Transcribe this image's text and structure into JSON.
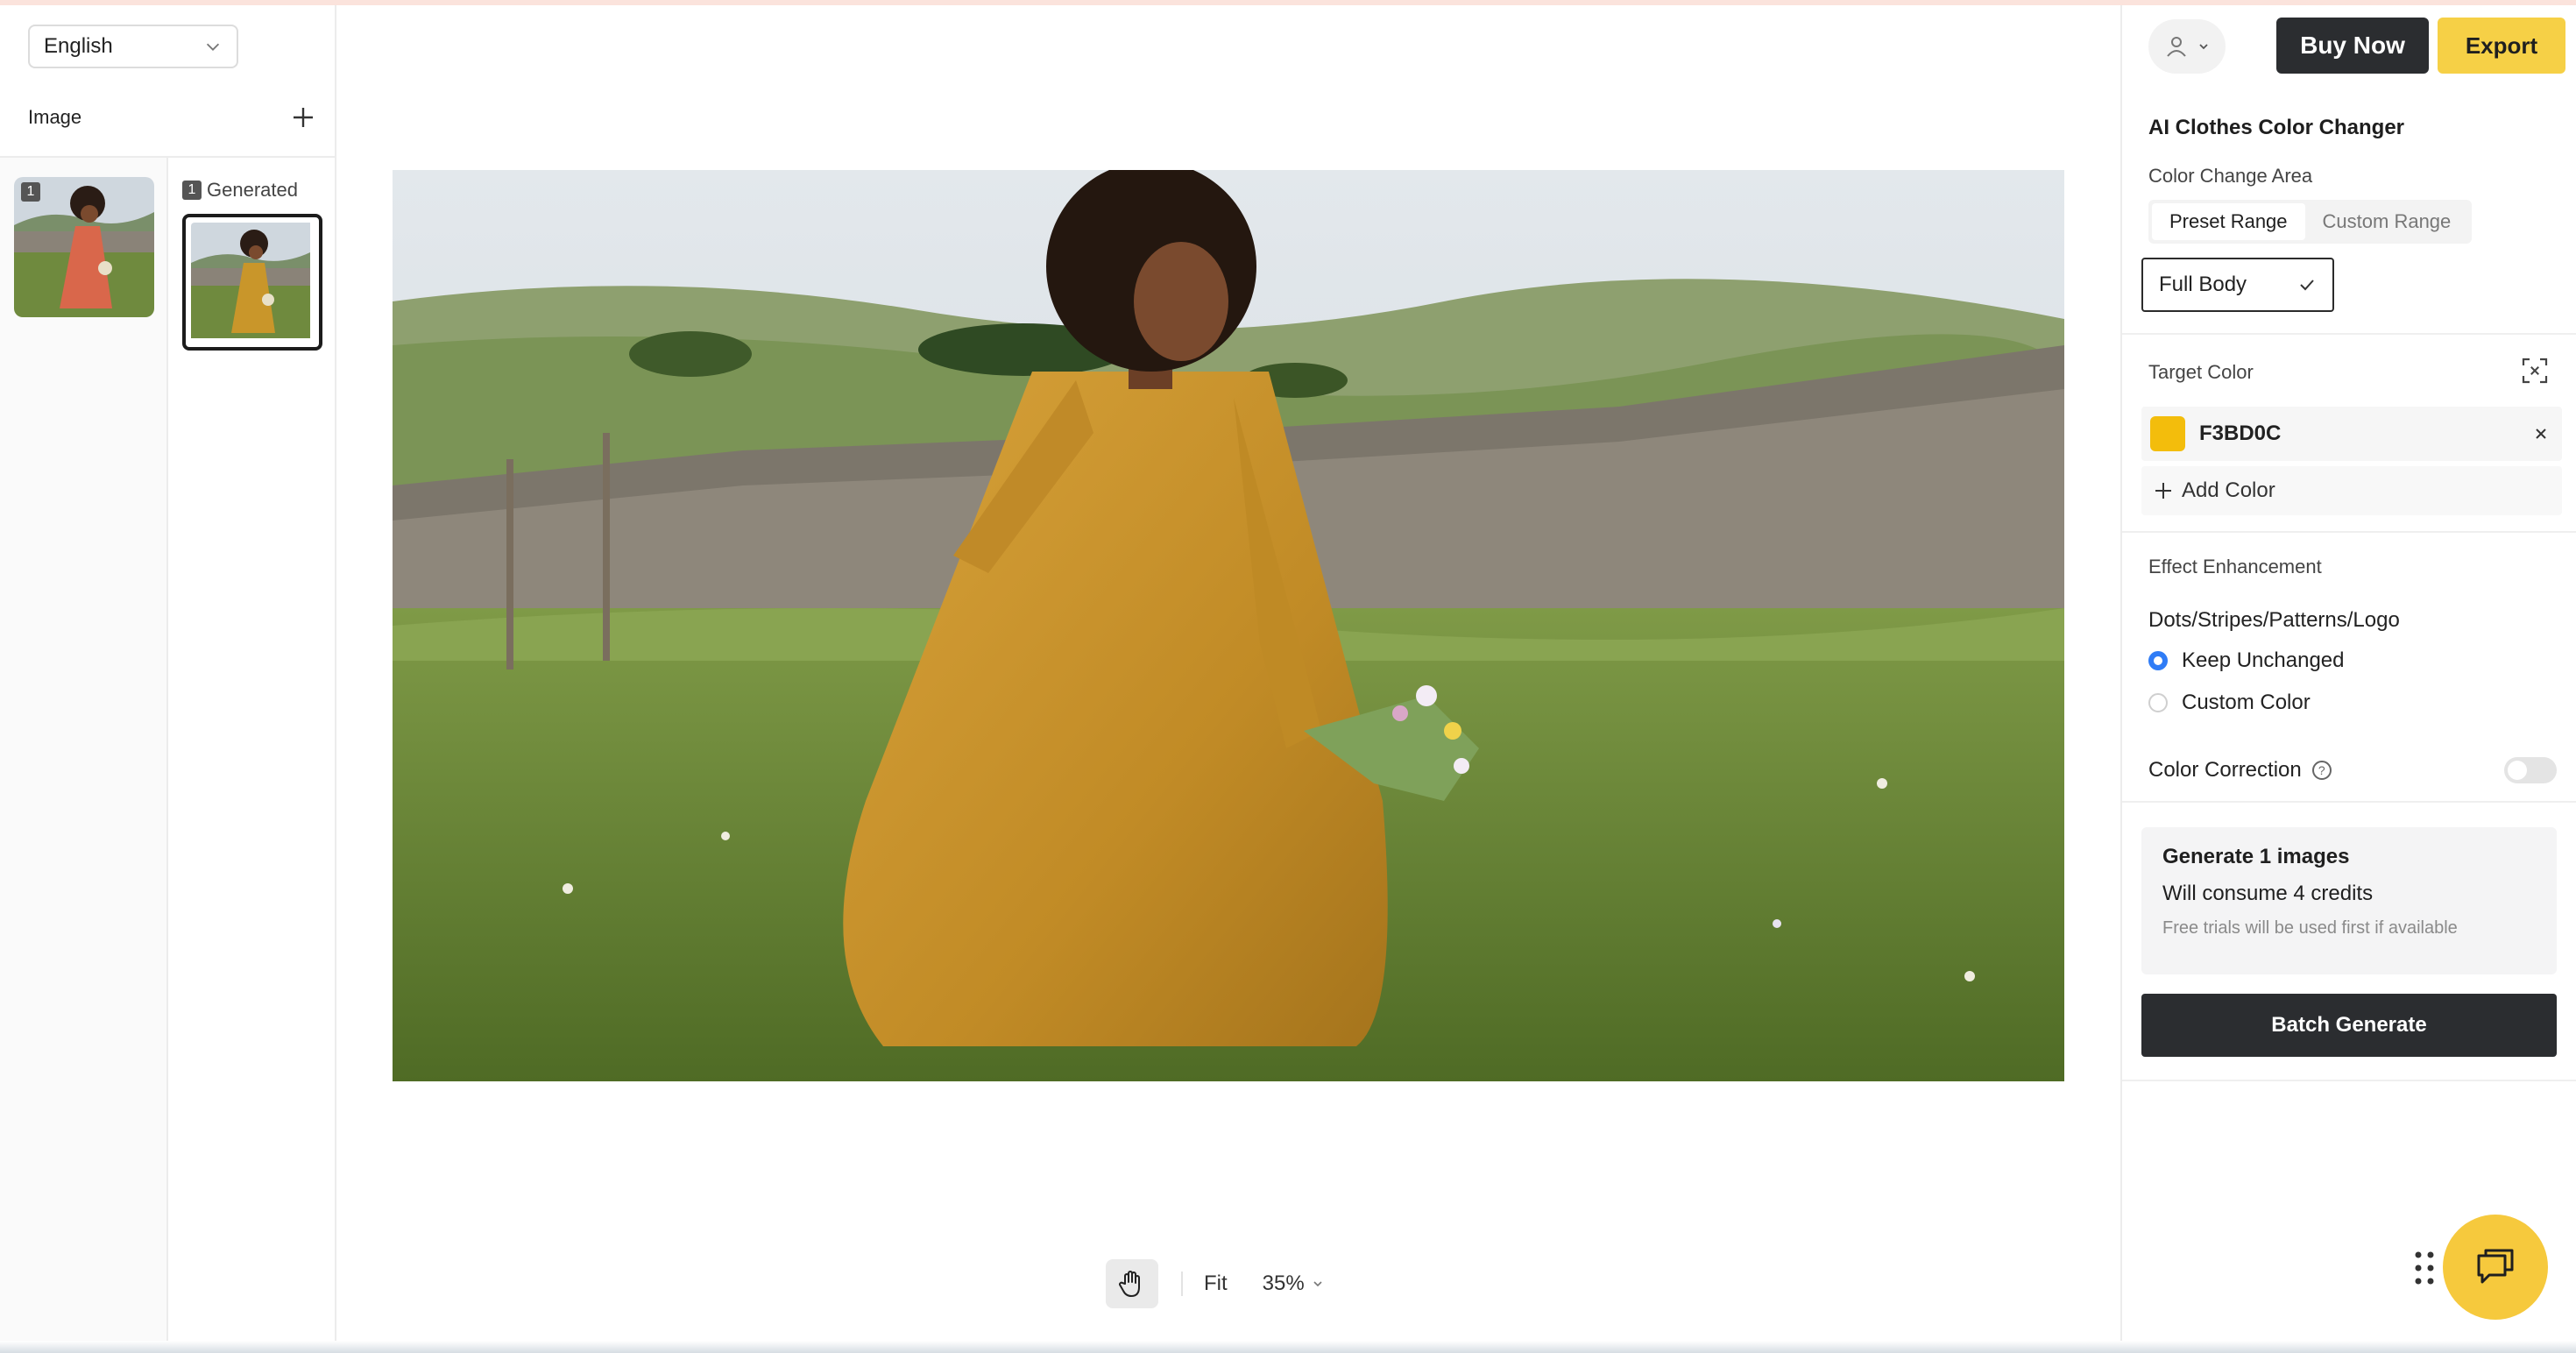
{
  "language": {
    "selected": "English"
  },
  "left_panel": {
    "image_title": "Image",
    "original_badge": "1",
    "generated_badge": "1",
    "generated_label": "Generated"
  },
  "toolbar": {
    "fit_label": "Fit",
    "zoom_label": "35%"
  },
  "header": {
    "buy_label": "Buy Now",
    "export_label": "Export"
  },
  "panel": {
    "tool_title": "AI Clothes Color Changer",
    "area_label": "Color Change Area",
    "tabs": [
      {
        "label": "Preset Range",
        "active": true
      },
      {
        "label": "Custom Range",
        "active": false
      }
    ],
    "area_value": "Full Body",
    "target_color_label": "Target Color",
    "target_color": {
      "hex_label": "F3BD0C",
      "swatch": "#F3BD0C"
    },
    "add_color_label": "Add Color",
    "effect_label": "Effect Enhancement",
    "pattern_title": "Dots/Stripes/Patterns/Logo",
    "options": [
      {
        "label": "Keep Unchanged",
        "selected": true
      },
      {
        "label": "Custom Color",
        "selected": false
      }
    ],
    "color_correction_label": "Color Correction",
    "color_correction_on": false,
    "generate": {
      "line1": "Generate 1 images",
      "line2": "Will consume 4 credits",
      "line3": "Free trials will be used first if available"
    },
    "batch_label": "Batch Generate"
  },
  "colors": {
    "accent_yellow": "#F6D046",
    "dark_button": "#2B2D30",
    "radio_blue": "#2F7CF6",
    "original_dress": "#D9674B",
    "generated_dress": "#C9962A"
  }
}
